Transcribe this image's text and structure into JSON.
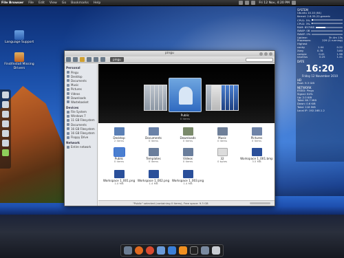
{
  "top_panel": {
    "app_name": "File Browser",
    "menus": [
      "File",
      "Edit",
      "View",
      "Go",
      "Bookmarks",
      "Help"
    ],
    "clock": "Fri 12 Nov, 4:20 PM"
  },
  "desktop_icons": [
    {
      "label": "Language Support"
    },
    {
      "label": "Find/Install Missing Drivers"
    }
  ],
  "window": {
    "title": "pingu",
    "breadcrumb": "pingu",
    "sidebar": {
      "personal_header": "Personal",
      "personal": [
        "Pingu",
        "Desktop",
        "Documents",
        "Music",
        "Pictures",
        "Videos",
        "Downloads",
        "Wastebasket"
      ],
      "devices_header": "Devices",
      "devices": [
        "File System",
        "Windows 7",
        "11 GB Filesystem",
        "Documents",
        "16 GB Filesystem",
        "16 GB Filesystem",
        "Floppy Drive"
      ],
      "network_header": "Network",
      "network": [
        "Entire network"
      ]
    },
    "coverflow": {
      "label": "Public",
      "sub": "0 items"
    },
    "files": [
      {
        "name": "Desktop",
        "size": "2 items",
        "color": "#5a7fb5"
      },
      {
        "name": "Documents",
        "size": "0 items",
        "color": "#6a82a8"
      },
      {
        "name": "Downloads",
        "size": "0 items",
        "color": "#7a8a6a"
      },
      {
        "name": "Music",
        "size": "0 items",
        "color": "#6e7f98"
      },
      {
        "name": "Pictures",
        "size": "0 items",
        "color": "#6f84a8"
      },
      {
        "name": "Public",
        "size": "0 items",
        "color": "#4a7fd0"
      },
      {
        "name": "Templates",
        "size": "0 items",
        "color": "#6a7e9c"
      },
      {
        "name": "Videos",
        "size": "0 items",
        "color": "#6a7e9c"
      },
      {
        "name": "32",
        "size": "0 bytes",
        "color": "#dcdcdc"
      },
      {
        "name": "Workspace 1_001.bmp",
        "size": "3.5 MB",
        "color": "#2a4f9a"
      },
      {
        "name": "Workspace 1_001.png",
        "size": "1.0 MB",
        "color": "#2a4f9a"
      },
      {
        "name": "Workspace 1_002.png",
        "size": "1.4 MB",
        "color": "#2a4f9a"
      },
      {
        "name": "Workspace 1_003.png",
        "size": "1.4 MB",
        "color": "#2a4f9a"
      }
    ],
    "status": "\"Public\" selected (containing 0 items), Free space: 9.3 GB"
  },
  "conky": {
    "system_header": "SYSTEM",
    "os_line1": "Ubuntu 10.10 (64)",
    "os_line2": "Kernel: 2.6.35-22-generic",
    "cpu": [
      {
        "label": "CPU1: 5%",
        "pct": 0.05
      },
      {
        "label": "CPU2: 3%",
        "pct": 0.03
      },
      {
        "label": "RAM: 857MiB",
        "pct": 0.35
      },
      {
        "label": "SWAP: 0B",
        "pct": 0.0
      },
      {
        "label": "SWAP: 0%",
        "pct": 0.0
      }
    ],
    "uptime_label": "Uptime:",
    "uptime": "3h 4m 13s",
    "processes_label": "Processes:",
    "processes": "229 (1 running)",
    "highest_label": "Highest",
    "procs": [
      {
        "name": "conky",
        "cpu": "1.04",
        "mem": "0.22"
      },
      {
        "name": "Xorg",
        "cpu": "0.78",
        "mem": "3.80"
      },
      {
        "name": "compiz",
        "cpu": "0.41",
        "mem": "1.98"
      },
      {
        "name": "nautilus",
        "cpu": "0.25",
        "mem": "1.41"
      }
    ],
    "date_header": "DATE",
    "time": "16:20",
    "date": "Friday 12 November 2010",
    "hd_header": "HD",
    "hd": [
      "Root: 9.3 GiB"
    ],
    "network_header": "NETWORK",
    "network": [
      "ESSID: Pingu",
      "Signal: 64%",
      "Up: 2.0 KiB",
      "Total: 60.7 MiB",
      "Down: 0.6 KiB",
      "Total: 118 MiB",
      "Local IP: 192.168.1.2"
    ]
  },
  "dock": {
    "items": [
      "home-folder-icon",
      "firefox-icon",
      "update-icon",
      "pidgin-icon",
      "dropbox-icon",
      "vlc-icon",
      "terminal-icon",
      "file-browser-icon",
      "trash-icon"
    ]
  }
}
